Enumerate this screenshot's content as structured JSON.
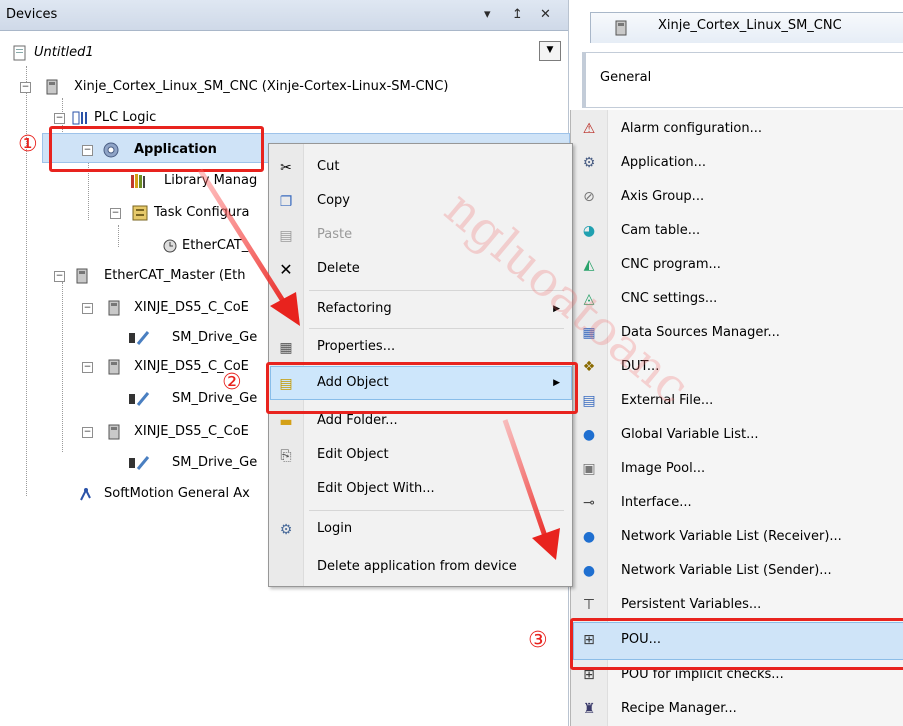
{
  "devices_panel": {
    "title": "Devices",
    "buttons": {
      "dropdown": "▾",
      "pin": "↥",
      "close": "✕"
    },
    "tree": [
      {
        "label": "Untitled1",
        "icon": "project-icon"
      },
      {
        "label": "Xinje_Cortex_Linux_SM_CNC (Xinje-Cortex-Linux-SM-CNC)",
        "icon": "device-icon"
      },
      {
        "label": "PLC Logic",
        "icon": "plc-logic-icon"
      },
      {
        "label": "Application",
        "icon": "gear-icon"
      },
      {
        "label": "Library Manag",
        "icon": "library-icon"
      },
      {
        "label": "Task Configura",
        "icon": "task-config-icon"
      },
      {
        "label": "EtherCAT_",
        "icon": "task-icon"
      },
      {
        "label": "EtherCAT_Master (Eth",
        "icon": "device-icon"
      },
      {
        "label": "XINJE_DS5_C_CoE",
        "icon": "device-icon"
      },
      {
        "label": "SM_Drive_Ge",
        "icon": "drive-icon"
      },
      {
        "label": "XINJE_DS5_C_CoE",
        "icon": "device-icon"
      },
      {
        "label": "SM_Drive_Ge",
        "icon": "drive-icon"
      },
      {
        "label": "XINJE_DS5_C_CoE",
        "icon": "device-icon"
      },
      {
        "label": "SM_Drive_Ge",
        "icon": "drive-icon"
      },
      {
        "label": "SoftMotion General Ax",
        "icon": "softmotion-icon"
      }
    ]
  },
  "context_menu": {
    "items": [
      {
        "label": "Cut",
        "icon": "scissors-icon"
      },
      {
        "label": "Copy",
        "icon": "copy-icon"
      },
      {
        "label": "Paste",
        "icon": "paste-icon",
        "disabled": true
      },
      {
        "label": "Delete",
        "icon": "delete-icon"
      },
      {
        "label": "Refactoring",
        "icon": "",
        "submenu": true
      },
      {
        "label": "Properties...",
        "icon": "properties-icon"
      },
      {
        "label": "Add Object",
        "icon": "add-object-icon",
        "submenu": true
      },
      {
        "label": "Add Folder...",
        "icon": "folder-icon"
      },
      {
        "label": "Edit Object",
        "icon": "edit-icon"
      },
      {
        "label": "Edit Object With...",
        "icon": ""
      },
      {
        "label": "Login",
        "icon": "login-icon"
      },
      {
        "label": "Delete application from device",
        "icon": ""
      }
    ]
  },
  "editor": {
    "tab_title": "Xinje_Cortex_Linux_SM_CNC",
    "general_label": "General"
  },
  "add_object_menu": {
    "items": [
      {
        "label": "Alarm configuration...",
        "icon": "alarm-icon"
      },
      {
        "label": "Application...",
        "icon": "gear-icon"
      },
      {
        "label": "Axis Group...",
        "icon": "axis-group-icon"
      },
      {
        "label": "Cam table...",
        "icon": "cam-icon"
      },
      {
        "label": "CNC program...",
        "icon": "cnc-program-icon"
      },
      {
        "label": "CNC settings...",
        "icon": "cnc-settings-icon"
      },
      {
        "label": "Data Sources Manager...",
        "icon": "data-sources-icon"
      },
      {
        "label": "DUT...",
        "icon": "dut-icon"
      },
      {
        "label": "External File...",
        "icon": "external-file-icon"
      },
      {
        "label": "Global Variable List...",
        "icon": "globe-icon"
      },
      {
        "label": "Image Pool...",
        "icon": "image-pool-icon"
      },
      {
        "label": "Interface...",
        "icon": "interface-icon"
      },
      {
        "label": "Network Variable List (Receiver)...",
        "icon": "globe-icon"
      },
      {
        "label": "Network Variable List (Sender)...",
        "icon": "globe-icon"
      },
      {
        "label": "Persistent Variables...",
        "icon": "persistent-icon"
      },
      {
        "label": "POU...",
        "icon": "pou-icon"
      },
      {
        "label": "POU for implicit checks...",
        "icon": "pou-icon"
      },
      {
        "label": "Recipe Manager...",
        "icon": "recipe-icon"
      }
    ]
  },
  "annotations": {
    "step1": "①",
    "step2": "②",
    "step3": "③"
  },
  "watermark": "ngluoatoanc",
  "colors": {
    "annotation_red": "#e8231e",
    "selection_blue": "#cde6fb"
  }
}
